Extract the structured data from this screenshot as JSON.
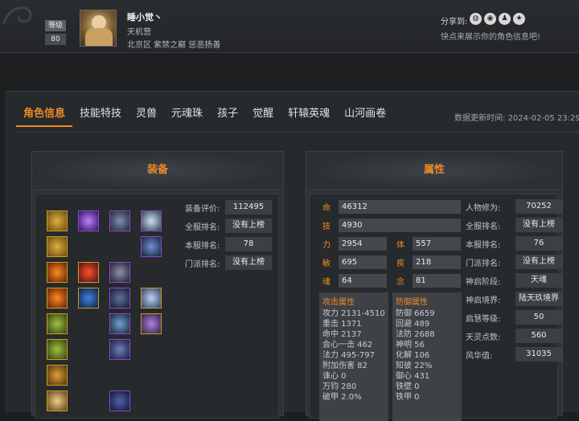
{
  "profile": {
    "level_label": "等级",
    "level": "80",
    "name": "睡小觉丶",
    "sect": "天机营",
    "server": "北京区 紫禁之巅 惩恶扬善"
  },
  "share": {
    "label": "分享到:",
    "tip": "快点来展示你的角色信息吧!"
  },
  "tabs": [
    "角色信息",
    "技能特技",
    "灵兽",
    "元魂珠",
    "孩子",
    "觉醒",
    "轩辕英魂",
    "山河画卷"
  ],
  "update": {
    "label": "数据更新时间:",
    "time": "2024-02-05 23:29"
  },
  "equipment": {
    "title": "装备",
    "rows": [
      {
        "label": "装备评价:",
        "value": "112495"
      },
      {
        "label": "全服排名:",
        "value": "没有上榜"
      },
      {
        "label": "本服排名:",
        "value": "78"
      },
      {
        "label": "门派排名:",
        "value": "没有上榜"
      }
    ]
  },
  "attributes": {
    "title": "属性",
    "stats": [
      {
        "k": "命",
        "v": "46312"
      },
      {
        "k": "技",
        "v": "4930"
      },
      {
        "k": "力",
        "v": "2954"
      },
      {
        "k": "体",
        "v": "557"
      },
      {
        "k": "敏",
        "v": "695"
      },
      {
        "k": "疾",
        "v": "218"
      },
      {
        "k": "魂",
        "v": "64"
      },
      {
        "k": "念",
        "v": "81"
      }
    ],
    "right": [
      {
        "label": "人物修为:",
        "value": "70252"
      },
      {
        "label": "全服排名:",
        "value": "没有上榜"
      },
      {
        "label": "本服排名:",
        "value": "76"
      },
      {
        "label": "门派排名:",
        "value": "没有上榜"
      },
      {
        "label": "神启阶段:",
        "value": "天魂"
      },
      {
        "label": "神启境界:",
        "value": "陆天玖境界"
      },
      {
        "label": "启慧等级:",
        "value": "50"
      },
      {
        "label": "天灵点数:",
        "value": "560"
      },
      {
        "label": "风华值:",
        "value": "31035"
      }
    ],
    "attack_title": "攻击属性",
    "attack": [
      "攻力 2131-4510",
      "重击 1371",
      "命中 2137",
      "会心一击 462",
      "法力 495-797",
      "附加伤害 82",
      "诛心 0",
      "万钧 280",
      "破甲 2.0%"
    ],
    "defense_title": "防御属性",
    "defense": [
      "防御 6659",
      "回避 489",
      "法防 2688",
      "神明 56",
      "化解 106",
      "知彼 22%",
      "御心 431",
      "铁壁 0",
      "铁甲 0"
    ]
  },
  "colors": {
    "accent": "#f08a24",
    "gold_border": "#c8a020",
    "purple_border": "#8a4ac8"
  }
}
